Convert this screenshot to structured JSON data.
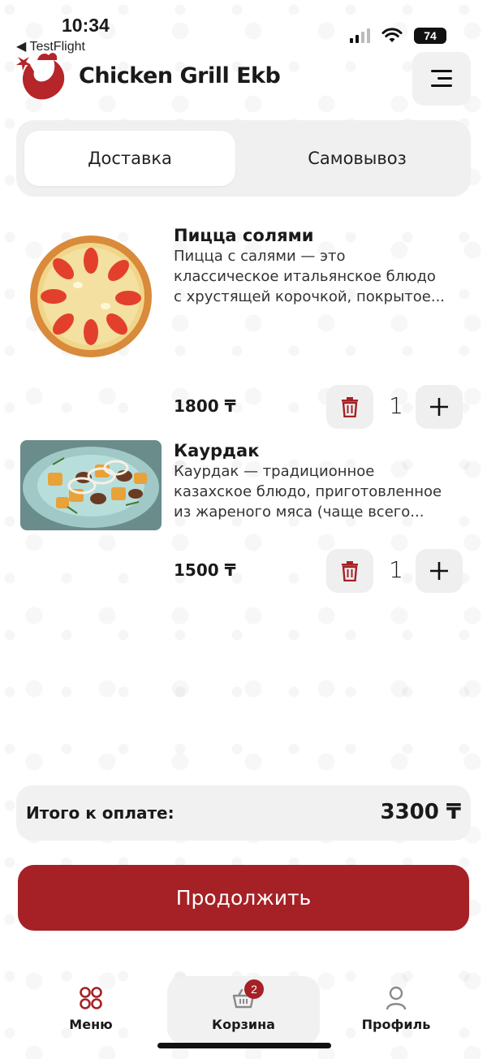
{
  "status_bar": {
    "time": "10:34",
    "back_app": "◀ TestFlight",
    "battery": "74"
  },
  "header": {
    "brand": "Chicken Grill Ekb",
    "menu_icon": "hamburger-icon",
    "logo_icon": "rooster-logo"
  },
  "tabs": [
    {
      "label": "Доставка",
      "active": true
    },
    {
      "label": "Самовывоз",
      "active": false
    }
  ],
  "cart_items": [
    {
      "title": "Пицца солями",
      "description_lines": [
        "Пицца с салями — это",
        "классическое итальянское блюдо",
        "с хрустящей корочкой, покрытое..."
      ],
      "price": "1800 ₸",
      "quantity": "1"
    },
    {
      "title": "Каурдак",
      "description_lines": [
        "Каурдак — традиционное",
        "казахское блюдо, приготовленное",
        "из жареного мяса (чаще всего..."
      ],
      "price": "1500 ₸",
      "quantity": "1"
    }
  ],
  "total": {
    "label": "Итого к оплате:",
    "value": "3300 ₸"
  },
  "continue_button": "Продолжить",
  "bottom_nav": {
    "menu": "Меню",
    "cart": "Корзина",
    "cart_badge": "2",
    "profile": "Профиль"
  },
  "colors": {
    "accent": "#a52125",
    "card_bg": "#f1f1f1"
  }
}
